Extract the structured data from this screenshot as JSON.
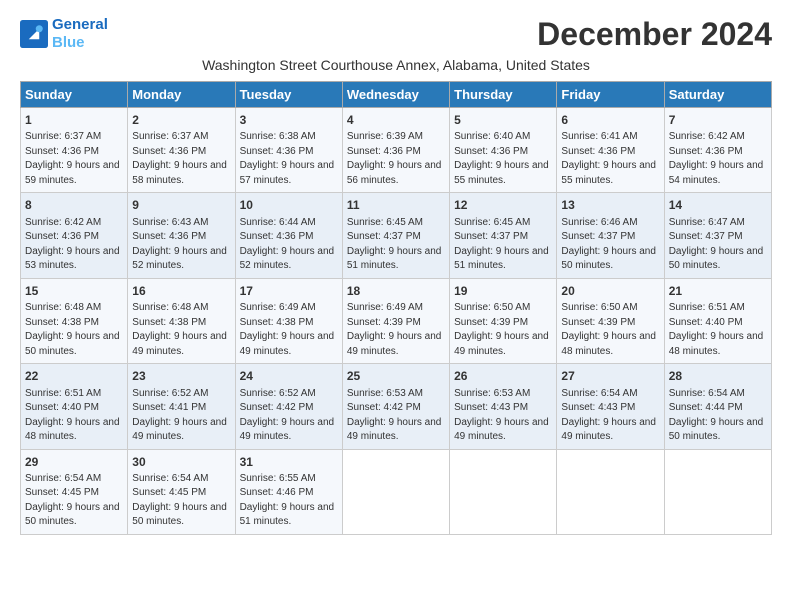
{
  "logo": {
    "line1": "General",
    "line2": "Blue"
  },
  "title": "December 2024",
  "location": "Washington Street Courthouse Annex, Alabama, United States",
  "days_of_week": [
    "Sunday",
    "Monday",
    "Tuesday",
    "Wednesday",
    "Thursday",
    "Friday",
    "Saturday"
  ],
  "weeks": [
    [
      {
        "day": 1,
        "sunrise": "6:37 AM",
        "sunset": "4:36 PM",
        "daylight": "9 hours and 59 minutes."
      },
      {
        "day": 2,
        "sunrise": "6:37 AM",
        "sunset": "4:36 PM",
        "daylight": "9 hours and 58 minutes."
      },
      {
        "day": 3,
        "sunrise": "6:38 AM",
        "sunset": "4:36 PM",
        "daylight": "9 hours and 57 minutes."
      },
      {
        "day": 4,
        "sunrise": "6:39 AM",
        "sunset": "4:36 PM",
        "daylight": "9 hours and 56 minutes."
      },
      {
        "day": 5,
        "sunrise": "6:40 AM",
        "sunset": "4:36 PM",
        "daylight": "9 hours and 55 minutes."
      },
      {
        "day": 6,
        "sunrise": "6:41 AM",
        "sunset": "4:36 PM",
        "daylight": "9 hours and 55 minutes."
      },
      {
        "day": 7,
        "sunrise": "6:42 AM",
        "sunset": "4:36 PM",
        "daylight": "9 hours and 54 minutes."
      }
    ],
    [
      {
        "day": 8,
        "sunrise": "6:42 AM",
        "sunset": "4:36 PM",
        "daylight": "9 hours and 53 minutes."
      },
      {
        "day": 9,
        "sunrise": "6:43 AM",
        "sunset": "4:36 PM",
        "daylight": "9 hours and 52 minutes."
      },
      {
        "day": 10,
        "sunrise": "6:44 AM",
        "sunset": "4:36 PM",
        "daylight": "9 hours and 52 minutes."
      },
      {
        "day": 11,
        "sunrise": "6:45 AM",
        "sunset": "4:37 PM",
        "daylight": "9 hours and 51 minutes."
      },
      {
        "day": 12,
        "sunrise": "6:45 AM",
        "sunset": "4:37 PM",
        "daylight": "9 hours and 51 minutes."
      },
      {
        "day": 13,
        "sunrise": "6:46 AM",
        "sunset": "4:37 PM",
        "daylight": "9 hours and 50 minutes."
      },
      {
        "day": 14,
        "sunrise": "6:47 AM",
        "sunset": "4:37 PM",
        "daylight": "9 hours and 50 minutes."
      }
    ],
    [
      {
        "day": 15,
        "sunrise": "6:48 AM",
        "sunset": "4:38 PM",
        "daylight": "9 hours and 50 minutes."
      },
      {
        "day": 16,
        "sunrise": "6:48 AM",
        "sunset": "4:38 PM",
        "daylight": "9 hours and 49 minutes."
      },
      {
        "day": 17,
        "sunrise": "6:49 AM",
        "sunset": "4:38 PM",
        "daylight": "9 hours and 49 minutes."
      },
      {
        "day": 18,
        "sunrise": "6:49 AM",
        "sunset": "4:39 PM",
        "daylight": "9 hours and 49 minutes."
      },
      {
        "day": 19,
        "sunrise": "6:50 AM",
        "sunset": "4:39 PM",
        "daylight": "9 hours and 49 minutes."
      },
      {
        "day": 20,
        "sunrise": "6:50 AM",
        "sunset": "4:39 PM",
        "daylight": "9 hours and 48 minutes."
      },
      {
        "day": 21,
        "sunrise": "6:51 AM",
        "sunset": "4:40 PM",
        "daylight": "9 hours and 48 minutes."
      }
    ],
    [
      {
        "day": 22,
        "sunrise": "6:51 AM",
        "sunset": "4:40 PM",
        "daylight": "9 hours and 48 minutes."
      },
      {
        "day": 23,
        "sunrise": "6:52 AM",
        "sunset": "4:41 PM",
        "daylight": "9 hours and 49 minutes."
      },
      {
        "day": 24,
        "sunrise": "6:52 AM",
        "sunset": "4:42 PM",
        "daylight": "9 hours and 49 minutes."
      },
      {
        "day": 25,
        "sunrise": "6:53 AM",
        "sunset": "4:42 PM",
        "daylight": "9 hours and 49 minutes."
      },
      {
        "day": 26,
        "sunrise": "6:53 AM",
        "sunset": "4:43 PM",
        "daylight": "9 hours and 49 minutes."
      },
      {
        "day": 27,
        "sunrise": "6:54 AM",
        "sunset": "4:43 PM",
        "daylight": "9 hours and 49 minutes."
      },
      {
        "day": 28,
        "sunrise": "6:54 AM",
        "sunset": "4:44 PM",
        "daylight": "9 hours and 50 minutes."
      }
    ],
    [
      {
        "day": 29,
        "sunrise": "6:54 AM",
        "sunset": "4:45 PM",
        "daylight": "9 hours and 50 minutes."
      },
      {
        "day": 30,
        "sunrise": "6:54 AM",
        "sunset": "4:45 PM",
        "daylight": "9 hours and 50 minutes."
      },
      {
        "day": 31,
        "sunrise": "6:55 AM",
        "sunset": "4:46 PM",
        "daylight": "9 hours and 51 minutes."
      },
      null,
      null,
      null,
      null
    ]
  ]
}
